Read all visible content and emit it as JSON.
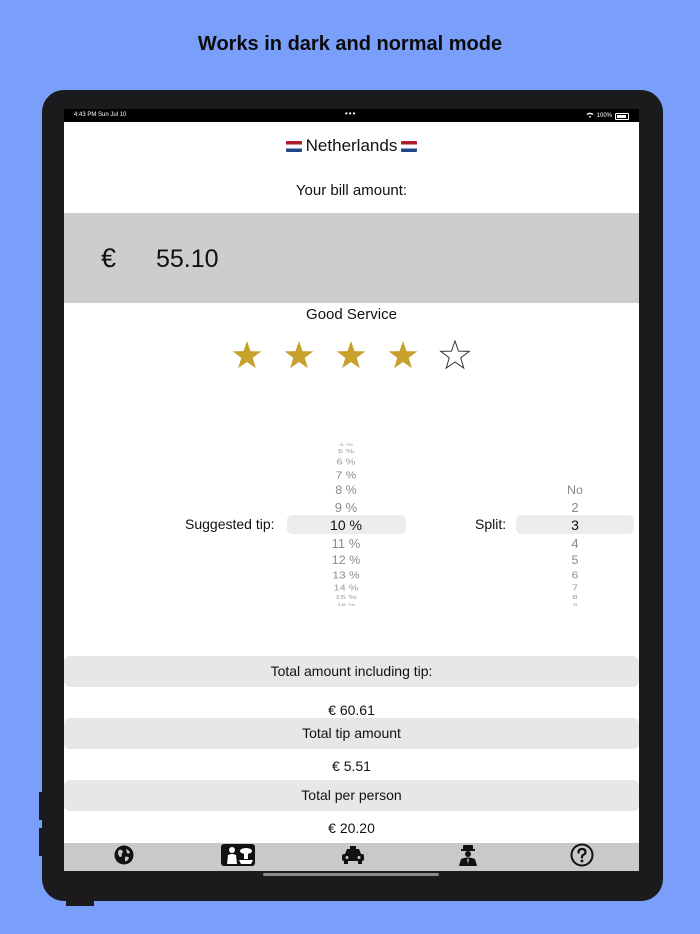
{
  "headline": "Works in dark and normal mode",
  "status": {
    "time": "4:43 PM   Sun Jul 10",
    "dots": "•••",
    "battery": "100%"
  },
  "country": "Netherlands",
  "bill": {
    "label": "Your bill amount:",
    "currency": "€",
    "amount": "55.10"
  },
  "rating": {
    "label": "Good Service",
    "stars_filled": 4,
    "stars_total": 5,
    "star_color": "#c8a12c"
  },
  "tip_picker": {
    "label": "Suggested tip:",
    "above": [
      "4 %",
      "5 %",
      "6 %",
      "7 %",
      "8 %",
      "9 %"
    ],
    "selected": "10 %",
    "below": [
      "11 %",
      "12 %",
      "13 %",
      "14 %",
      "15 %",
      "16 %"
    ]
  },
  "split_picker": {
    "label": "Split:",
    "above": [
      "No",
      "2"
    ],
    "selected": "3",
    "below": [
      "4",
      "5",
      "6",
      "7",
      "8",
      "9"
    ]
  },
  "results": {
    "total_label": "Total amount including tip:",
    "total_value": "€ 60.61",
    "tip_label": "Total tip amount",
    "tip_value": "€ 5.51",
    "per_person_label": "Total per person",
    "per_person_value": "€ 20.20"
  },
  "tabs": [
    {
      "icon": "globe-icon"
    },
    {
      "icon": "waiter-icon",
      "selected": true
    },
    {
      "icon": "taxi-icon"
    },
    {
      "icon": "bellhop-icon"
    },
    {
      "icon": "help-icon"
    }
  ]
}
